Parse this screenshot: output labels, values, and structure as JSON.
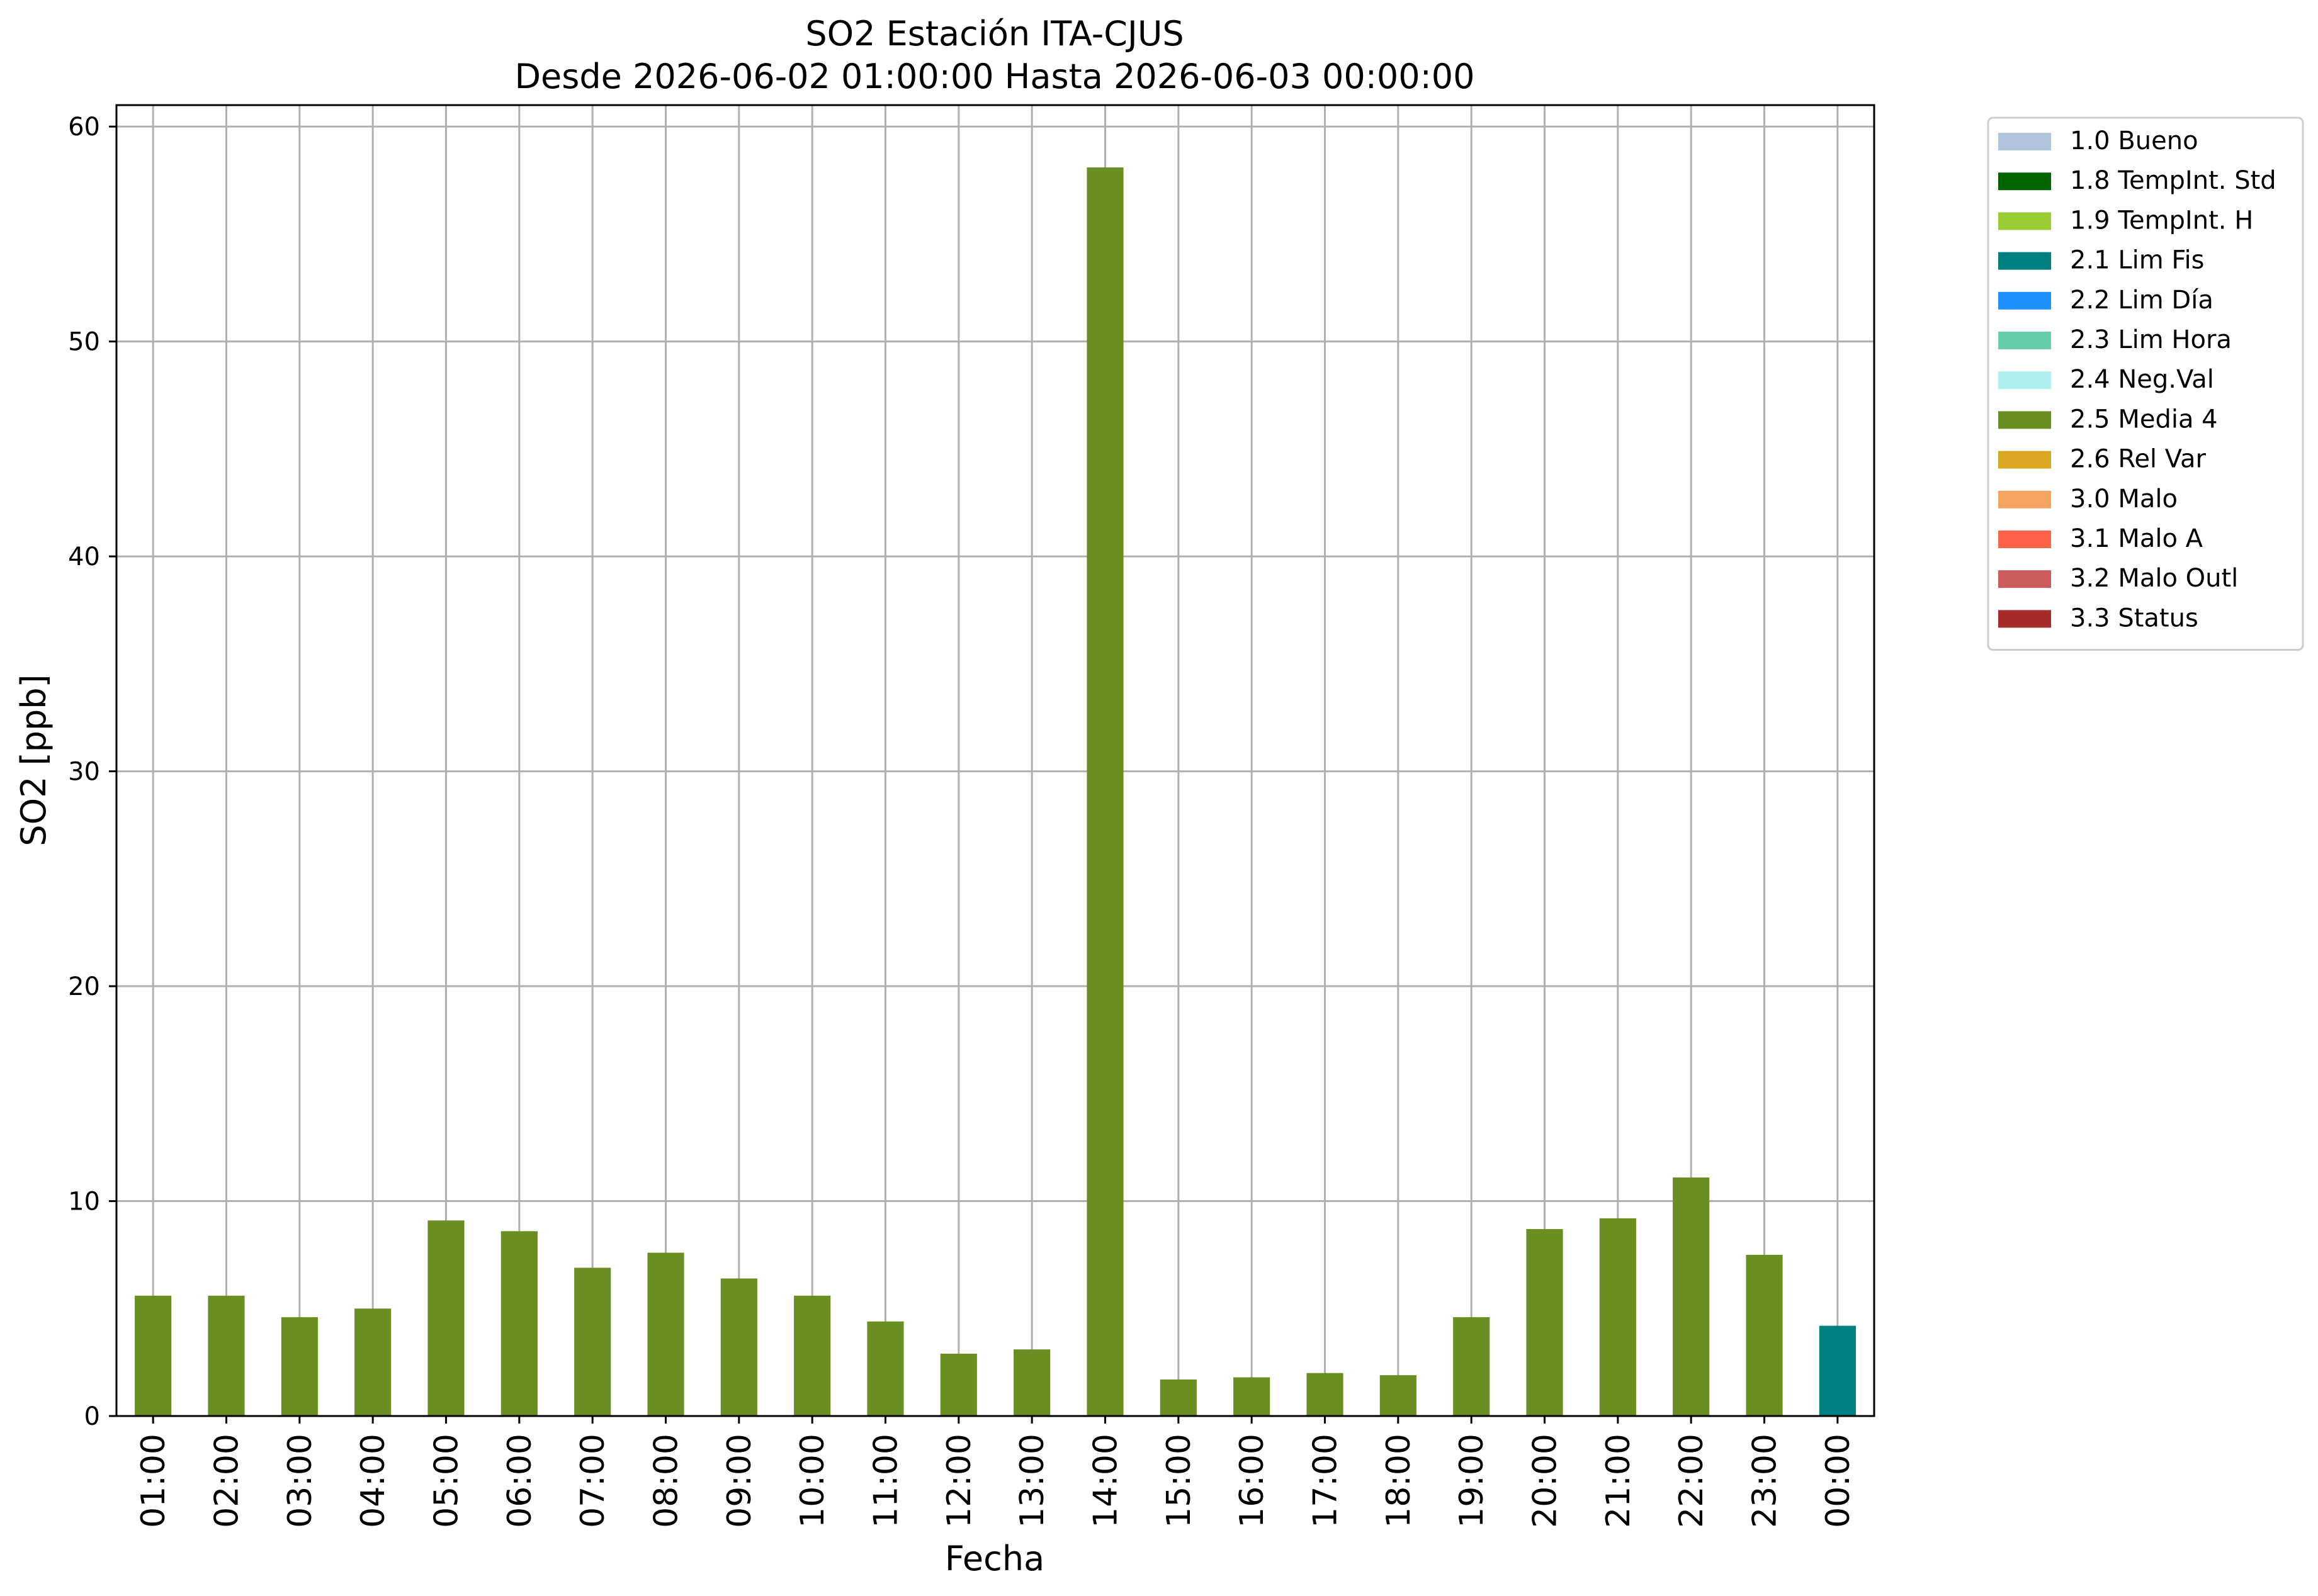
{
  "chart_data": {
    "type": "bar",
    "title": "SO2 Estación ITA-CJUS",
    "subtitle": "Desde 2026-06-02 01:00:00 Hasta 2026-06-03 00:00:00",
    "xlabel": "Fecha",
    "ylabel": "SO2 [ppb]",
    "ylim": [
      0,
      61
    ],
    "yticks": [
      0,
      10,
      20,
      30,
      40,
      50,
      60
    ],
    "grid": true,
    "legend_position": "outside-right",
    "categories": [
      "01:00",
      "02:00",
      "03:00",
      "04:00",
      "05:00",
      "06:00",
      "07:00",
      "08:00",
      "09:00",
      "10:00",
      "11:00",
      "12:00",
      "13:00",
      "14:00",
      "15:00",
      "16:00",
      "17:00",
      "18:00",
      "19:00",
      "20:00",
      "21:00",
      "22:00",
      "23:00",
      "00:00"
    ],
    "values": [
      5.6,
      5.6,
      4.6,
      5.0,
      9.1,
      8.6,
      6.9,
      7.6,
      6.4,
      5.6,
      4.4,
      2.9,
      3.1,
      58.1,
      1.7,
      1.8,
      2.0,
      1.9,
      4.6,
      8.7,
      9.2,
      11.1,
      7.5,
      4.2
    ],
    "bar_flags": [
      "2.5 Media 4",
      "2.5 Media 4",
      "2.5 Media 4",
      "2.5 Media 4",
      "2.5 Media 4",
      "2.5 Media 4",
      "2.5 Media 4",
      "2.5 Media 4",
      "2.5 Media 4",
      "2.5 Media 4",
      "2.5 Media 4",
      "2.5 Media 4",
      "2.5 Media 4",
      "2.5 Media 4",
      "2.5 Media 4",
      "2.5 Media 4",
      "2.5 Media 4",
      "2.5 Media 4",
      "2.5 Media 4",
      "2.5 Media 4",
      "2.5 Media 4",
      "2.5 Media 4",
      "2.5 Media 4",
      "2.1 Lim Fis"
    ],
    "legend": [
      {
        "label": "1.0 Bueno",
        "color": "#b0c4de"
      },
      {
        "label": "1.8 TempInt. Std",
        "color": "#006400"
      },
      {
        "label": "1.9 TempInt. H",
        "color": "#9acd32"
      },
      {
        "label": "2.1 Lim Fis",
        "color": "#008080"
      },
      {
        "label": "2.2 Lim Día",
        "color": "#1e90ff"
      },
      {
        "label": "2.3 Lim Hora",
        "color": "#66cdaa"
      },
      {
        "label": "2.4 Neg.Val",
        "color": "#afeeee"
      },
      {
        "label": "2.5 Media 4",
        "color": "#6b8e23"
      },
      {
        "label": "2.6 Rel Var",
        "color": "#daa520"
      },
      {
        "label": "3.0 Malo",
        "color": "#f4a460"
      },
      {
        "label": "3.1 Malo A",
        "color": "#ff6347"
      },
      {
        "label": "3.2 Malo Outl",
        "color": "#cd5c5c"
      },
      {
        "label": "3.3 Status",
        "color": "#a52a2a"
      }
    ]
  }
}
